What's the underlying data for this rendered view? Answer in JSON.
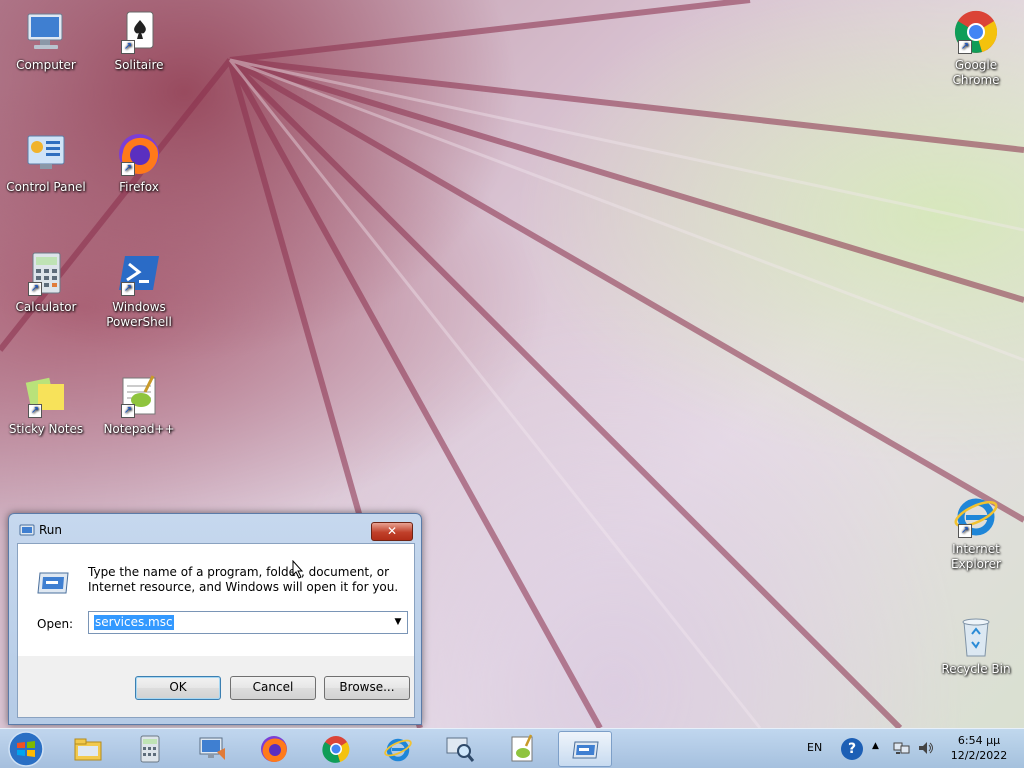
{
  "desktop": {
    "icons": [
      {
        "label": "Computer"
      },
      {
        "label": "Solitaire"
      },
      {
        "label": "Google Chrome"
      },
      {
        "label": "Control Panel"
      },
      {
        "label": "Firefox"
      },
      {
        "label": "Calculator"
      },
      {
        "label": "Windows PowerShell"
      },
      {
        "label": "Sticky Notes"
      },
      {
        "label": "Notepad++"
      },
      {
        "label": "Internet Explorer"
      },
      {
        "label": "Recycle Bin"
      }
    ]
  },
  "run_dialog": {
    "title": "Run",
    "close_label": "✕",
    "description": "Type the name of a program, folder, document, or Internet resource, and Windows will open it for you.",
    "open_label": "Open:",
    "open_value": "services.msc",
    "ok_label": "OK",
    "cancel_label": "Cancel",
    "browse_label": "Browse..."
  },
  "taskbar": {
    "pinned": [
      {
        "icon": "windows-explorer-icon"
      },
      {
        "icon": "calculator-icon"
      },
      {
        "icon": "remote-desktop-icon"
      },
      {
        "icon": "firefox-icon"
      },
      {
        "icon": "chrome-icon"
      },
      {
        "icon": "internet-explorer-icon"
      },
      {
        "icon": "magnifier-icon"
      },
      {
        "icon": "notepadpp-icon"
      },
      {
        "icon": "run-icon"
      }
    ],
    "tray": {
      "language": "EN",
      "help": "?",
      "time": "6:54 μμ",
      "date": "12/2/2022"
    }
  },
  "colors": {
    "accent": "#1d5fb5",
    "selection": "#3399ff",
    "close_red": "#c0402a"
  }
}
